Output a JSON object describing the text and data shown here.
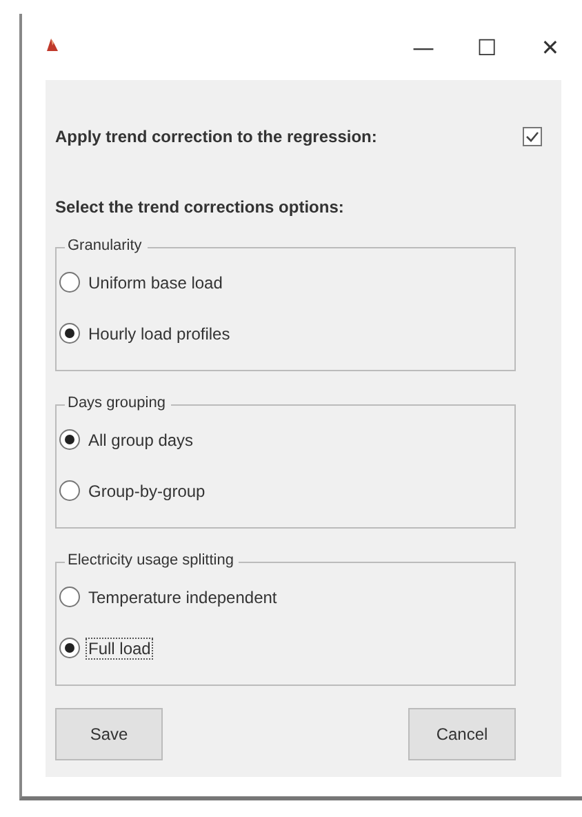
{
  "window": {
    "title_buttons": [
      "—",
      "☐",
      "✕"
    ]
  },
  "apply": {
    "label": "Apply trend correction to the regression:",
    "checked": true
  },
  "section_title": "Select the trend corrections options:",
  "groups": [
    {
      "title": "Granularity",
      "options": [
        {
          "label": "Uniform base load",
          "selected": false,
          "focused": false
        },
        {
          "label": "Hourly load profiles",
          "selected": true,
          "focused": false
        }
      ]
    },
    {
      "title": "Days grouping",
      "options": [
        {
          "label": "All group days",
          "selected": true,
          "focused": false
        },
        {
          "label": "Group-by-group",
          "selected": false,
          "focused": false
        }
      ]
    },
    {
      "title": "Electricity usage splitting",
      "options": [
        {
          "label": "Temperature independent",
          "selected": false,
          "focused": false
        },
        {
          "label": "Full load",
          "selected": true,
          "focused": true
        }
      ]
    }
  ],
  "buttons": [
    "Save",
    "Cancel"
  ]
}
